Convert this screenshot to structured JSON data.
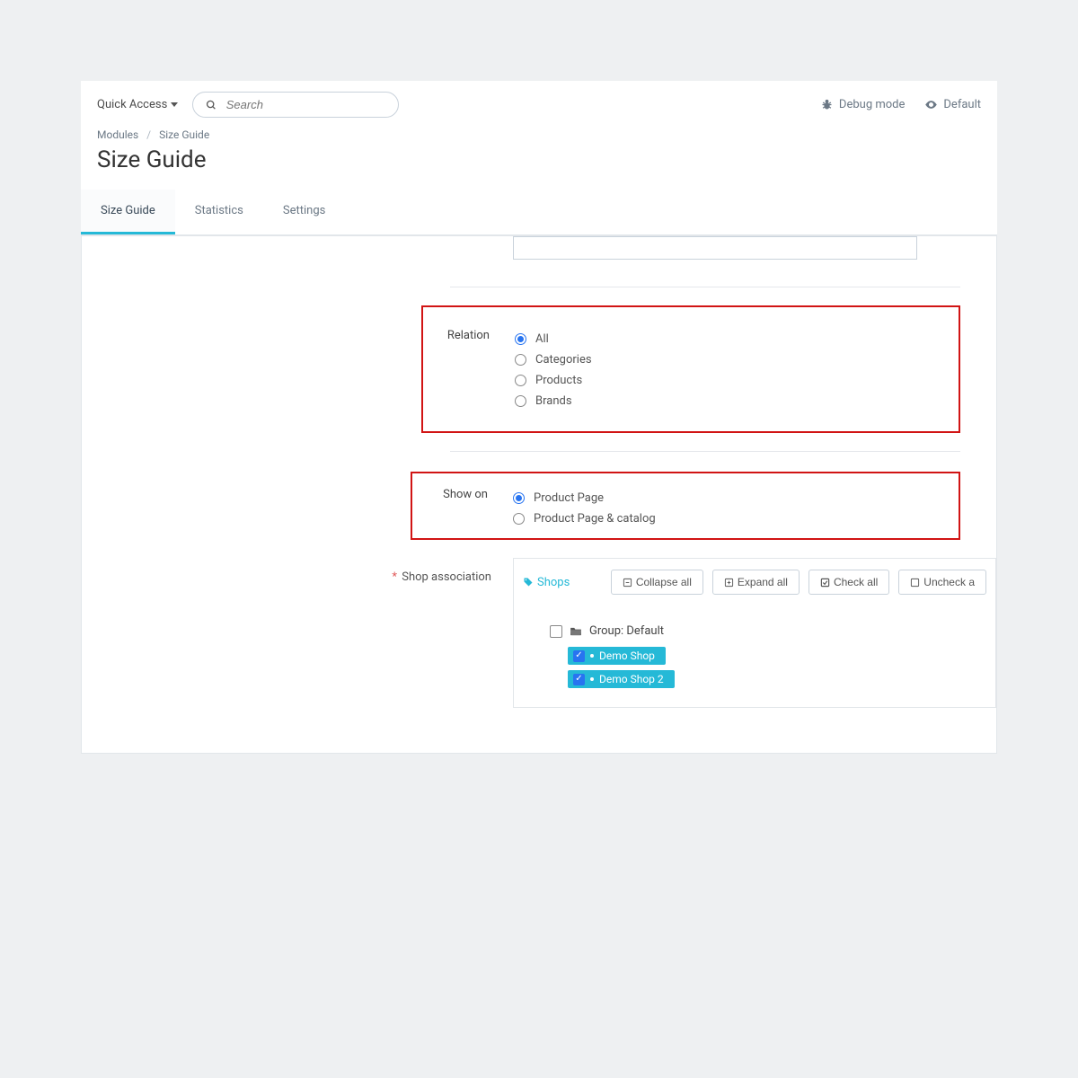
{
  "topbar": {
    "quick_access": "Quick Access",
    "search_placeholder": "Search",
    "debug_mode": "Debug mode",
    "default": "Default"
  },
  "breadcrumb": {
    "item1": "Modules",
    "item2": "Size Guide"
  },
  "page_title": "Size Guide",
  "tabs": {
    "size_guide": "Size Guide",
    "statistics": "Statistics",
    "settings": "Settings"
  },
  "form": {
    "relation": {
      "label": "Relation",
      "options": {
        "all": "All",
        "categories": "Categories",
        "products": "Products",
        "brands": "Brands"
      }
    },
    "show_on": {
      "label": "Show on",
      "options": {
        "product_page": "Product Page",
        "product_page_catalog": "Product Page & catalog"
      }
    },
    "shop_association": {
      "label": "Shop association",
      "shops_label": "Shops",
      "buttons": {
        "collapse": "Collapse all",
        "expand": "Expand all",
        "check": "Check all",
        "uncheck": "Uncheck a"
      },
      "tree": {
        "group_label": "Group: Default",
        "shop1": "Demo Shop",
        "shop2": "Demo Shop 2"
      }
    }
  }
}
